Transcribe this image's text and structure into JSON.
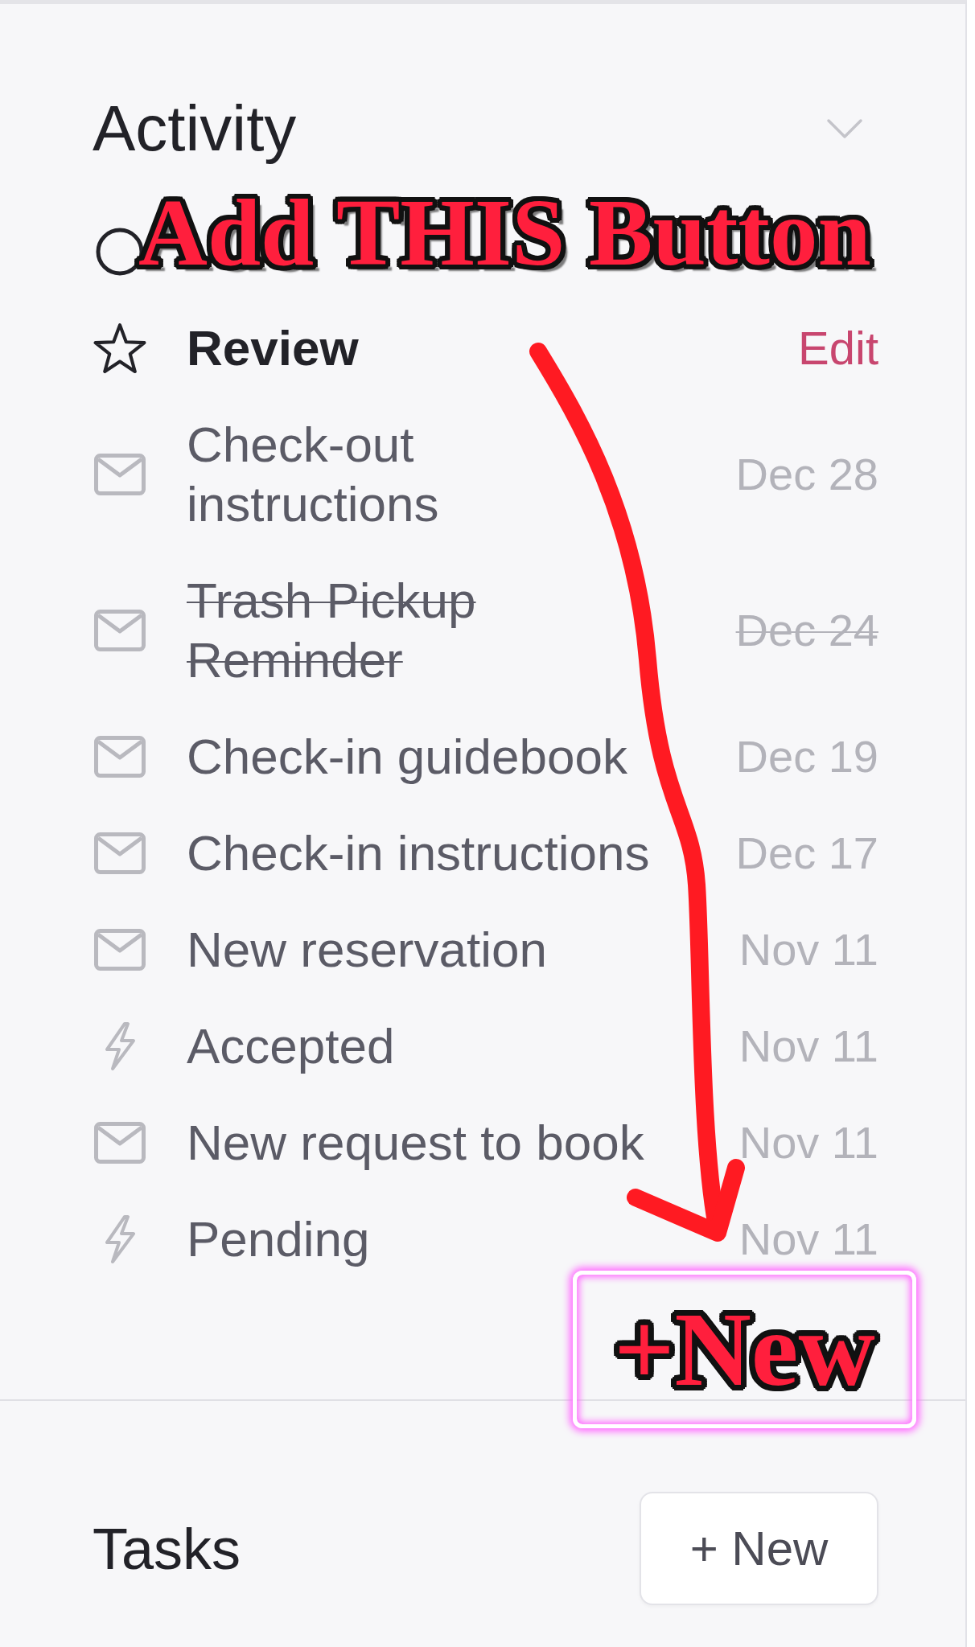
{
  "activity": {
    "title": "Activity",
    "expanded": true,
    "items": [
      {
        "kind": "todo"
      },
      {
        "kind": "review",
        "lines": [
          "Review"
        ],
        "action": "Edit",
        "done": false
      },
      {
        "kind": "message",
        "lines": [
          "Check-out",
          "instructions"
        ],
        "date": "Dec 28",
        "done": false
      },
      {
        "kind": "message",
        "lines": [
          "Trash Pickup",
          "Reminder"
        ],
        "date": "Dec 24",
        "done": true
      },
      {
        "kind": "message",
        "lines": [
          "Check-in guidebook"
        ],
        "date": "Dec 19",
        "done": false
      },
      {
        "kind": "message",
        "lines": [
          "Check-in instructions"
        ],
        "date": "Dec 17",
        "done": false
      },
      {
        "kind": "message",
        "lines": [
          "New reservation"
        ],
        "date": "Nov 11",
        "done": false
      },
      {
        "kind": "trigger",
        "lines": [
          "Accepted"
        ],
        "date": "Nov 11",
        "done": false
      },
      {
        "kind": "message",
        "lines": [
          "New request to book"
        ],
        "date": "Nov 11",
        "done": false
      },
      {
        "kind": "trigger",
        "lines": [
          "Pending"
        ],
        "date": "Nov 11",
        "done": false
      }
    ]
  },
  "tasks": {
    "title": "Tasks",
    "new_button": "+ New"
  },
  "annotation": {
    "caption": "Add THIS Button",
    "highlight_label": "+New"
  }
}
